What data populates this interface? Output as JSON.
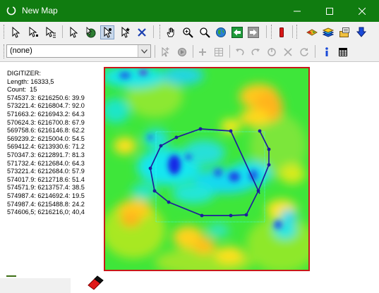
{
  "window": {
    "title": "New Map",
    "controls": [
      "minimize",
      "maximize",
      "close"
    ]
  },
  "toolbar_top": {
    "buttons": [
      {
        "name": "select-icon",
        "tooltip": ""
      },
      {
        "name": "select-node-icon",
        "tooltip": ""
      },
      {
        "name": "select-list-icon",
        "tooltip": ""
      },
      {
        "name": "pointer-icon",
        "tooltip": ""
      },
      {
        "name": "globe-select-icon",
        "tooltip": ""
      },
      {
        "name": "digitize-icon",
        "tooltip": "",
        "pressed": true
      },
      {
        "name": "pointer-star-icon",
        "tooltip": ""
      },
      {
        "name": "clear-icon",
        "tooltip": ""
      },
      {
        "name": "pan-hand-icon",
        "tooltip": ""
      },
      {
        "name": "zoom-in-icon",
        "tooltip": ""
      },
      {
        "name": "zoom-icon",
        "tooltip": ""
      },
      {
        "name": "globe-icon",
        "tooltip": ""
      },
      {
        "name": "back-arrow-icon",
        "tooltip": ""
      },
      {
        "name": "forward-arrow-icon",
        "tooltip": ""
      },
      {
        "name": "red-marker-icon",
        "tooltip": ""
      },
      {
        "name": "layer-add-icon",
        "tooltip": ""
      },
      {
        "name": "layers-icon",
        "tooltip": ""
      },
      {
        "name": "properties-icon",
        "tooltip": ""
      },
      {
        "name": "download-icon",
        "tooltip": ""
      }
    ]
  },
  "toolbar_edit": {
    "layer_select_value": "(none)",
    "buttons": [
      "add-node-icon",
      "edit-shape-icon",
      "plus-icon",
      "grid-icon",
      "undo-icon",
      "redo-icon",
      "rotate-icon",
      "delete-icon",
      "refresh-icon",
      "info-icon",
      "table-icon"
    ]
  },
  "digitizer": {
    "header": "DIGITIZER:",
    "length_label": "Length: 16333,5",
    "count_label": "Count:  15",
    "points": [
      "574537.3: 6216250.6: 39.9",
      "573221.4: 6216804.7: 92.0",
      "571663.2: 6216943.2: 64.3",
      "570624.3: 6216700.8: 67.9",
      "569758.6: 6216146.8: 62.2",
      "569239.2: 6215004.0: 54.5",
      "569412.4: 6213930.6: 71.2",
      "570347.3: 6212891.7: 81.3",
      "571732.4: 6212684.0: 64.3",
      "573221.4: 6212684.0: 57.9",
      "574017.9: 6212718.6: 51.4",
      "574571.9: 6213757.4: 38.5",
      "574987.4: 6214692.4: 19.5",
      "574987.4: 6215488.8: 24.2",
      "574606,5; 6216216,0; 40,4"
    ]
  },
  "map": {
    "palette": {
      "low": "#9a4a28",
      "mid_low": "#ff8c1a",
      "mid": "#ffe81a",
      "green": "#18e618",
      "cyan": "#18e6ff",
      "blue": "#1428e6",
      "frame": "#c81818",
      "polygon": "#1e1e9c"
    }
  }
}
